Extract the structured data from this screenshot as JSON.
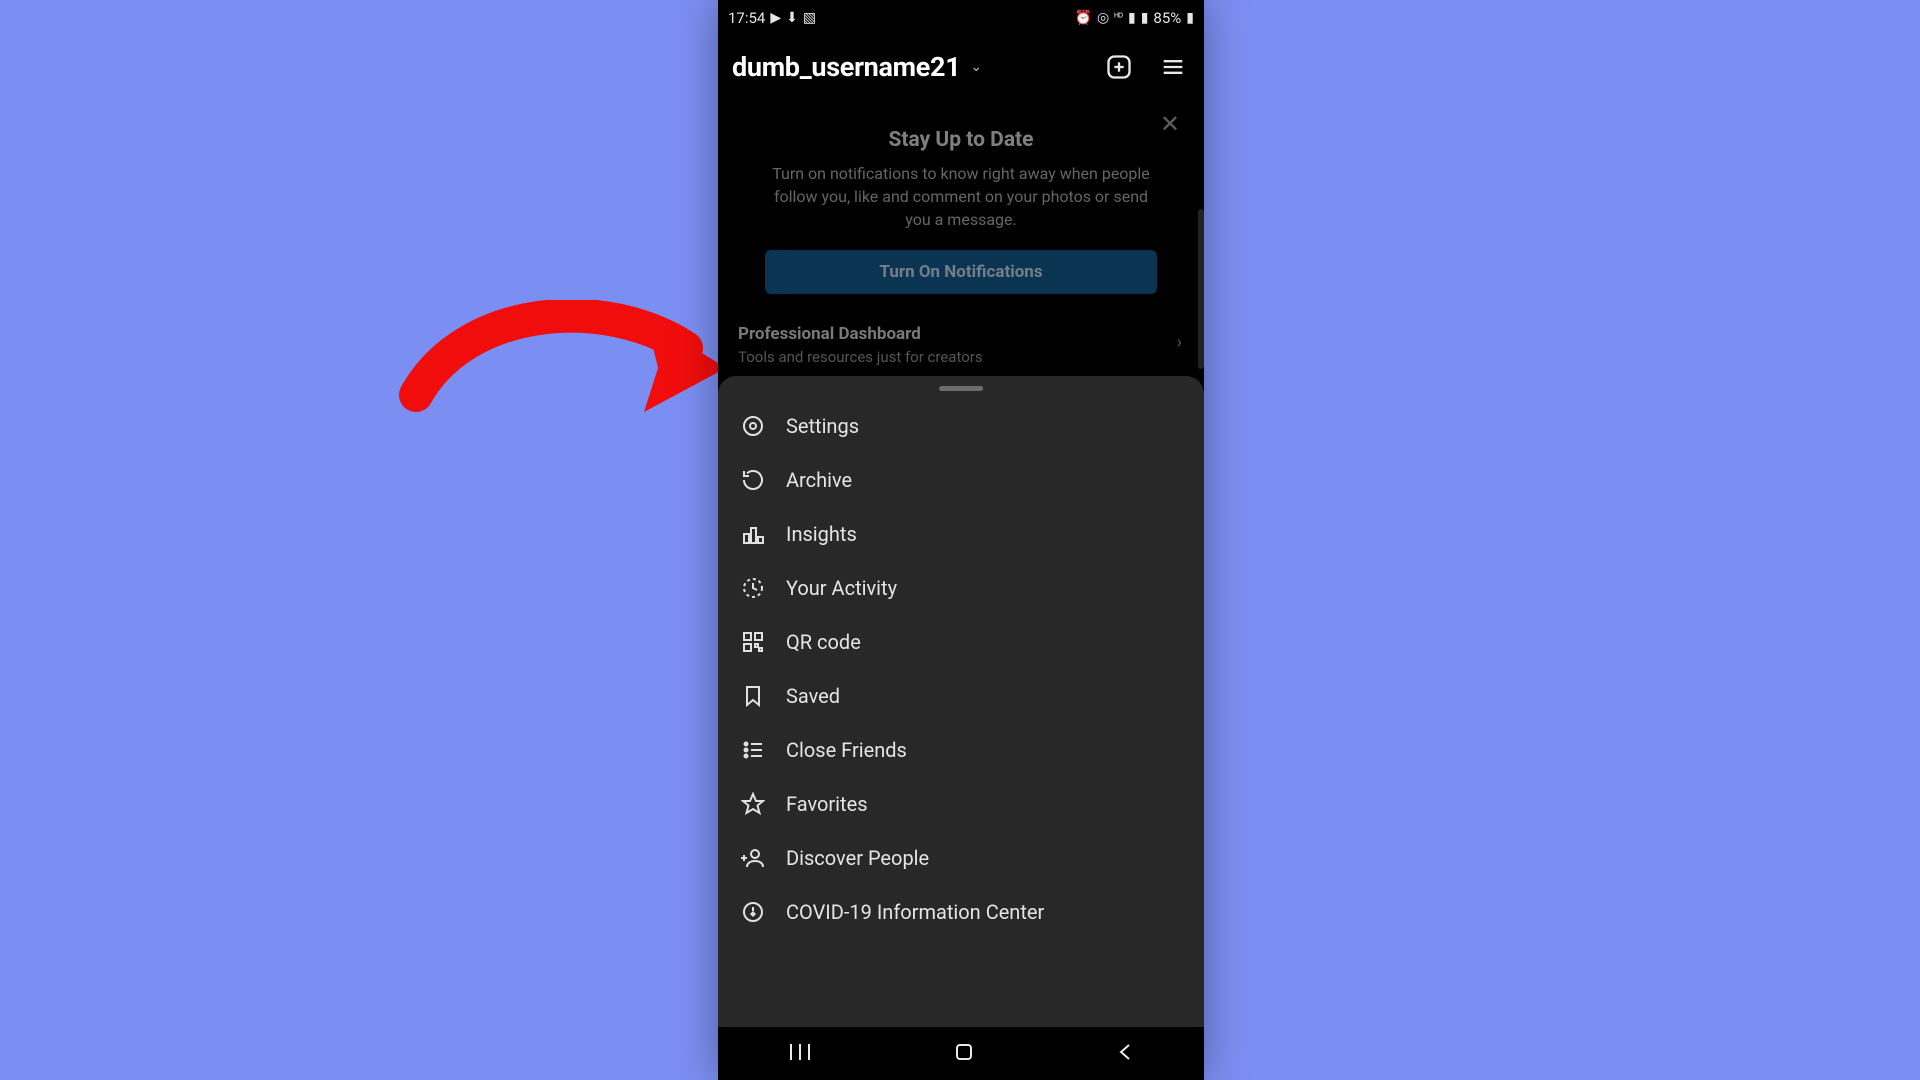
{
  "status": {
    "time": "17:54",
    "battery": "85%"
  },
  "appbar": {
    "username": "dumb_username21"
  },
  "card": {
    "title": "Stay Up to Date",
    "subtitle": "Turn on notifications to know right away when people follow you, like and comment on your photos or send you a message.",
    "button": "Turn On Notifications"
  },
  "dashboard": {
    "title": "Professional Dashboard",
    "subtitle": "Tools and resources just for creators"
  },
  "menu": {
    "settings": "Settings",
    "archive": "Archive",
    "insights": "Insights",
    "activity": "Your Activity",
    "qr": "QR code",
    "saved": "Saved",
    "close_friends": "Close Friends",
    "favorites": "Favorites",
    "discover": "Discover People",
    "covid": "COVID-19 Information Center"
  }
}
